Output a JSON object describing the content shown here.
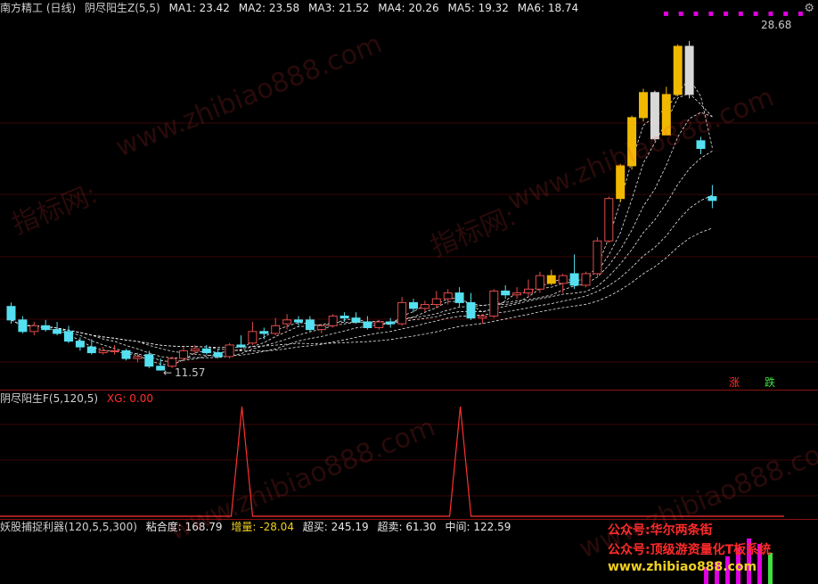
{
  "main_header": {
    "title": "南方精工 (日线)",
    "indicator": "阴尽阳生Z(5,5)",
    "ma1": "MA1: 23.42",
    "ma2": "MA2: 23.58",
    "ma3": "MA3: 21.52",
    "ma4": "MA4: 20.26",
    "ma5": "MA5: 19.32",
    "ma6": "MA6: 18.74"
  },
  "price_labels": {
    "high": "28.68",
    "low": "11.57"
  },
  "tags": {
    "up": "涨",
    "down": "跌"
  },
  "panel2": {
    "name": "阴尽阳生F(5,120,5)",
    "xg": "XG: 0.00"
  },
  "panel3": {
    "name": "妖股捕捉利器(120,5,5,300)",
    "nianhedu": "粘合度: 168.79",
    "zengliang": "增量: -28.04",
    "chaomai": "超买: 245.19",
    "chaomai2": "超卖: 61.30",
    "zhongjian": "中间: 122.59"
  },
  "watermarks": {
    "site": "www.zhibiao888.com",
    "cn": "指标网:"
  },
  "promos": {
    "line1": "公众号:华尔两条街",
    "line2": "公众号:顶级游资量化T板系统",
    "line3": "www.zhibiao888.com"
  },
  "colors": {
    "up": "#e24a4a",
    "down": "#54e0f0",
    "gold": "#f0b800",
    "white": "#d8d8d8",
    "grid": "#8a1010",
    "line": "#ff3030"
  },
  "chart_data": {
    "type": "candlestick",
    "series_ohlc": [
      [
        14.9,
        15.1,
        14.0,
        14.2
      ],
      [
        14.2,
        14.4,
        13.5,
        13.6
      ],
      [
        13.6,
        14.1,
        13.4,
        13.9
      ],
      [
        13.9,
        14.2,
        13.6,
        13.7
      ],
      [
        13.7,
        14.1,
        13.4,
        13.5
      ],
      [
        13.6,
        13.9,
        13.0,
        13.1
      ],
      [
        13.1,
        13.3,
        12.6,
        12.8
      ],
      [
        12.8,
        13.2,
        12.4,
        12.5
      ],
      [
        12.5,
        12.8,
        12.4,
        12.6
      ],
      [
        12.6,
        12.9,
        12.4,
        12.6
      ],
      [
        12.6,
        12.7,
        12.1,
        12.2
      ],
      [
        12.2,
        12.5,
        12.0,
        12.3
      ],
      [
        12.4,
        12.6,
        11.7,
        11.8
      ],
      [
        11.8,
        12.2,
        11.57,
        11.6
      ],
      [
        11.8,
        12.3,
        11.7,
        12.2
      ],
      [
        12.2,
        12.8,
        12.1,
        12.6
      ],
      [
        12.6,
        12.9,
        12.4,
        12.7
      ],
      [
        12.7,
        12.9,
        12.4,
        12.5
      ],
      [
        12.5,
        12.7,
        12.2,
        12.3
      ],
      [
        12.3,
        13.0,
        12.2,
        12.9
      ],
      [
        12.9,
        13.4,
        12.8,
        12.8
      ],
      [
        13.0,
        14.1,
        12.9,
        13.6
      ],
      [
        13.6,
        13.8,
        13.2,
        13.5
      ],
      [
        13.5,
        14.3,
        13.4,
        13.9
      ],
      [
        14.0,
        14.5,
        13.7,
        14.2
      ],
      [
        14.2,
        14.4,
        13.9,
        14.1
      ],
      [
        14.2,
        14.4,
        13.6,
        13.7
      ],
      [
        13.7,
        14.0,
        13.5,
        13.9
      ],
      [
        13.9,
        14.5,
        13.8,
        14.4
      ],
      [
        14.4,
        14.6,
        14.1,
        14.3
      ],
      [
        14.3,
        14.6,
        14.0,
        14.1
      ],
      [
        14.1,
        14.4,
        13.7,
        13.8
      ],
      [
        13.8,
        14.2,
        13.7,
        14.1
      ],
      [
        14.1,
        14.3,
        13.8,
        14.0
      ],
      [
        14.0,
        15.4,
        13.9,
        15.1
      ],
      [
        15.1,
        15.3,
        14.6,
        14.8
      ],
      [
        14.8,
        15.2,
        14.6,
        15.0
      ],
      [
        15.0,
        15.7,
        14.8,
        15.3
      ],
      [
        15.3,
        15.8,
        15.0,
        15.6
      ],
      [
        15.6,
        15.9,
        14.9,
        15.1
      ],
      [
        15.1,
        15.6,
        14.2,
        14.3
      ],
      [
        14.3,
        14.5,
        14.0,
        14.4
      ],
      [
        14.4,
        15.8,
        14.3,
        15.7
      ],
      [
        15.7,
        16.0,
        15.3,
        15.5
      ],
      [
        15.5,
        15.9,
        15.3,
        15.6
      ],
      [
        15.6,
        16.3,
        15.4,
        15.8
      ],
      [
        15.8,
        16.7,
        15.6,
        16.5
      ],
      [
        16.5,
        16.8,
        16.0,
        16.1
      ],
      [
        16.1,
        16.6,
        15.6,
        16.5
      ],
      [
        16.6,
        17.6,
        15.8,
        16.0
      ],
      [
        16.0,
        16.7,
        15.9,
        16.6
      ],
      [
        16.6,
        18.5,
        16.4,
        18.3
      ],
      [
        18.3,
        20.6,
        18.2,
        20.5
      ],
      [
        20.5,
        22.3,
        20.3,
        22.2
      ],
      [
        22.2,
        24.8,
        22.0,
        24.7
      ],
      [
        24.7,
        26.2,
        24.5,
        26.0
      ],
      [
        26.0,
        26.1,
        23.5,
        23.6
      ],
      [
        23.8,
        26.3,
        23.8,
        25.9
      ],
      [
        25.9,
        28.5,
        25.8,
        28.4
      ],
      [
        28.4,
        28.68,
        25.7,
        25.9
      ],
      [
        23.5,
        23.7,
        22.8,
        23.1
      ],
      [
        20.6,
        21.2,
        20.0,
        20.4
      ]
    ],
    "ylim": [
      11.0,
      29.6
    ],
    "annotations": {
      "high": "28.68",
      "low": "11.57"
    },
    "signal_series": {
      "name": "XG",
      "peaks": [
        [
          20,
          1
        ],
        [
          39,
          1
        ]
      ],
      "range": [
        0,
        1
      ]
    }
  }
}
